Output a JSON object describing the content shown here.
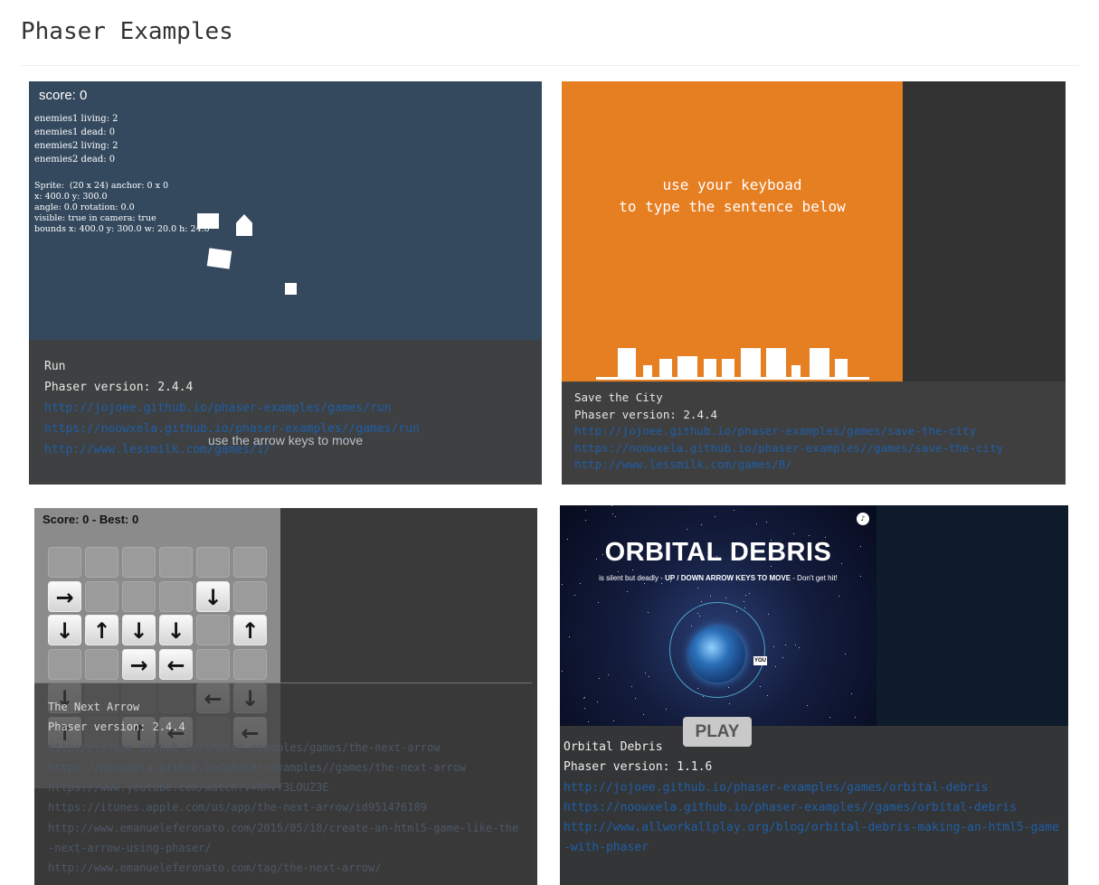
{
  "page": {
    "title": "Phaser Examples"
  },
  "cards": [
    {
      "name": "Run",
      "version": "Phaser version: 2.4.4",
      "links": [
        "http://jojoee.github.io/phaser-examples/games/run",
        "https://noowxela.github.io/phaser-examples//games/run",
        "http://www.lessmilk.com/games/1/"
      ],
      "game": {
        "score": "score: 0",
        "debug_lines": "enemies1 living: 2\nenemies1 dead: 0\nenemies2 living: 2\nenemies2 dead: 0",
        "sprite_lines": "Sprite:  (20 x 24) anchor: 0 x 0\nx: 400.0 y: 300.0\nangle: 0.0 rotation: 0.0\nvisible: true in camera: true\nbounds x: 400.0 y: 300.0 w: 20.0 h: 24.0",
        "hint": "use the arrow keys to move",
        "background": "#34495e"
      }
    },
    {
      "name": "Save the City",
      "version": "Phaser version: 2.4.4",
      "links": [
        "http://jojoee.github.io/phaser-examples/games/save-the-city",
        "https://noowxela.github.io/phaser-examples//games/save-the-city",
        "http://www.lessmilk.com/games/8/"
      ],
      "game": {
        "line1": "use your keyboad",
        "line2": "to type the sentence below",
        "background": "#e67e22"
      }
    },
    {
      "name": "The Next Arrow",
      "version": "Phaser version: 2.4.4",
      "links": [
        "http://jojoee.github.io/phaser-examples/games/the-next-arrow",
        "https://noowxela.github.io/phaser-examples//games/the-next-arrow",
        "https://www.youtube.com/watch?v=NhvY3LOUZ3E",
        "https://itunes.apple.com/us/app/the-next-arrow/id951476189",
        "http://www.emanueleferonato.com/2015/05/18/create-an-html5-game-like-the-next-arrow-using-phaser/",
        "http://www.emanueleferonato.com/tag/the-next-arrow/"
      ],
      "game": {
        "score": "Score: 0 - Best: 0",
        "grid": [
          [
            "",
            "",
            "",
            "",
            "",
            ""
          ],
          [
            "→",
            "",
            "",
            "",
            "↓",
            ""
          ],
          [
            "↓",
            "↑",
            "↓",
            "↓",
            "",
            "↑"
          ],
          [
            "",
            "",
            "→",
            "←",
            "",
            ""
          ],
          [
            "↓",
            "",
            "",
            "",
            "←",
            "↓"
          ],
          [
            "↑",
            "",
            "↑",
            "←",
            "",
            "←"
          ]
        ]
      }
    },
    {
      "name": "Orbital Debris",
      "version": "Phaser version: 1.1.6",
      "links": [
        "http://jojoee.github.io/phaser-examples/games/orbital-debris",
        "https://noowxela.github.io/phaser-examples//games/orbital-debris",
        "http://www.allworkallplay.org/blog/orbital-debris-making-an-html5-game-with-phaser"
      ],
      "game": {
        "title": "ORBITAL DEBRIS",
        "subtitle_pre": "is silent but deadly - ",
        "subtitle_bold": "UP / DOWN ARROW KEYS TO MOVE",
        "subtitle_post": " - Don't get hit!",
        "you_label": "YOU",
        "play_label": "PLAY",
        "sound_icon": "speaker-icon"
      }
    }
  ]
}
